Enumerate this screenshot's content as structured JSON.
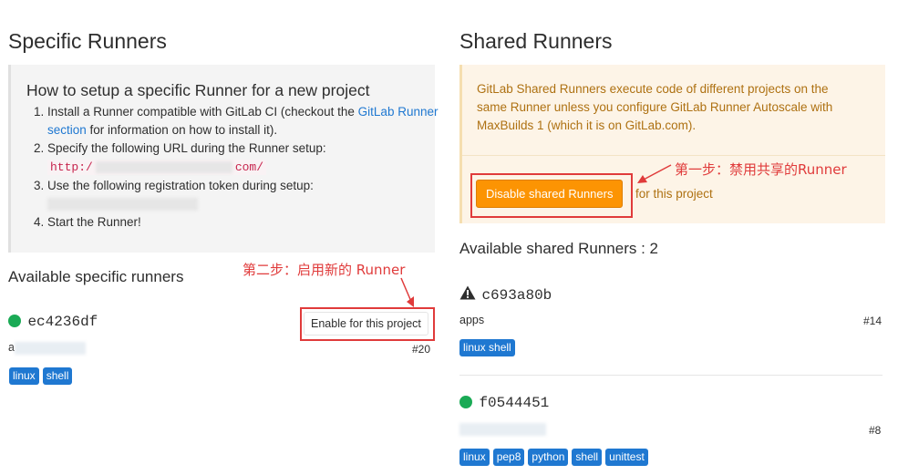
{
  "specific": {
    "title": "Specific Runners",
    "setup_title": "How to setup a specific Runner for a new project",
    "step1_pre": "Install a Runner compatible with GitLab CI (checkout the ",
    "step1_link": "GitLab Runner section",
    "step1_post": " for information on how to install it).",
    "step2": "Specify the following URL during the Runner setup:",
    "url_prefix": "http:/",
    "url_suffix": "com/",
    "step3": "Use the following registration token during setup:",
    "step4": "Start the Runner!",
    "available_title": "Available specific runners",
    "runner": {
      "id": "ec4236df",
      "desc_prefix": "a",
      "number": "#20",
      "tags": [
        "linux",
        "shell"
      ],
      "enable_button": "Enable for this project"
    },
    "annotation": "第二步：启用新的 Runner"
  },
  "shared": {
    "title": "Shared Runners",
    "warning": "GitLab Shared Runners execute code of different projects on the same Runner unless you configure GitLab Runner Autoscale with MaxBuilds 1 (which it is on GitLab.com).",
    "disable_button": "Disable shared Runners",
    "for_project": "for this project",
    "annotation": "第一步：禁用共享的Runner",
    "available_title": "Available shared Runners : 2",
    "runners": [
      {
        "id": "c693a80b",
        "status_icon": "warning-icon",
        "desc": "apps",
        "number": "#14",
        "tags": [
          "linux shell"
        ]
      },
      {
        "id": "f0544451",
        "status_icon": "online-dot",
        "desc": "",
        "number": "#8",
        "tags": [
          "linux",
          "pep8",
          "python",
          "shell",
          "unittest"
        ]
      }
    ]
  },
  "colors": {
    "link": "#1f78d1",
    "badge": "#1f78d1",
    "online": "#1aaa55",
    "warning_bg": "#fdf4e7",
    "warning_text": "#ae7112",
    "orange_button": "#fc9403",
    "annotation_red": "#e03b3b"
  }
}
